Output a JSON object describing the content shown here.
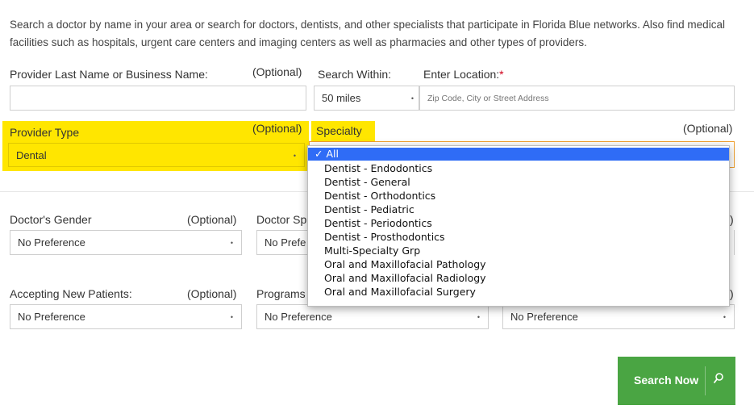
{
  "intro": "Search a doctor by name in your area or search for doctors, dentists, and other specialists that participate in Florida Blue networks. Also find medical facilities such as hospitals, urgent care centers and imaging centers as well as pharmacies and other types of providers.",
  "provider_name": {
    "label": "Provider Last Name or Business Name:",
    "optional": "(Optional)",
    "value": ""
  },
  "search_within": {
    "label": "Search Within:",
    "value": "50 miles"
  },
  "location": {
    "label": "Enter Location:",
    "required_mark": "*",
    "placeholder": "Zip Code, City or Street Address"
  },
  "provider_type": {
    "label": "Provider Type",
    "optional": "(Optional)",
    "value": "Dental"
  },
  "specialty": {
    "label": "Specialty",
    "optional": "(Optional)",
    "options": [
      "✓ All",
      "Dentist - Endodontics",
      "Dentist - General",
      "Dentist - Orthodontics",
      "Dentist - Pediatric",
      "Dentist - Periodontics",
      "Dentist - Prosthodontics",
      "Multi-Specialty Grp",
      "Oral and Maxillofacial Pathology",
      "Oral and Maxillofacial Radiology",
      "Oral and Maxillofacial Surgery"
    ],
    "selected_index": 0
  },
  "gender": {
    "label": "Doctor's Gender",
    "optional": "(Optional)",
    "value": "No Preference"
  },
  "doctor_speaks": {
    "label": "Doctor Sp",
    "value": "No Prefe"
  },
  "col3_row2": {
    "optional_partial": ")"
  },
  "accepting": {
    "label": "Accepting New Patients:",
    "optional": "(Optional)",
    "value": "No Preference"
  },
  "programs": {
    "label": "Programs",
    "value": "No Preference"
  },
  "col3_row3": {
    "optional_partial": ")",
    "value": "No Preference"
  },
  "search_button": {
    "label": "Search Now",
    "icon": "search-icon"
  },
  "colors": {
    "highlight": "#ffe600",
    "button": "#4aa543",
    "dropdown_selected": "#2f6cf6",
    "required": "#d0021b"
  }
}
